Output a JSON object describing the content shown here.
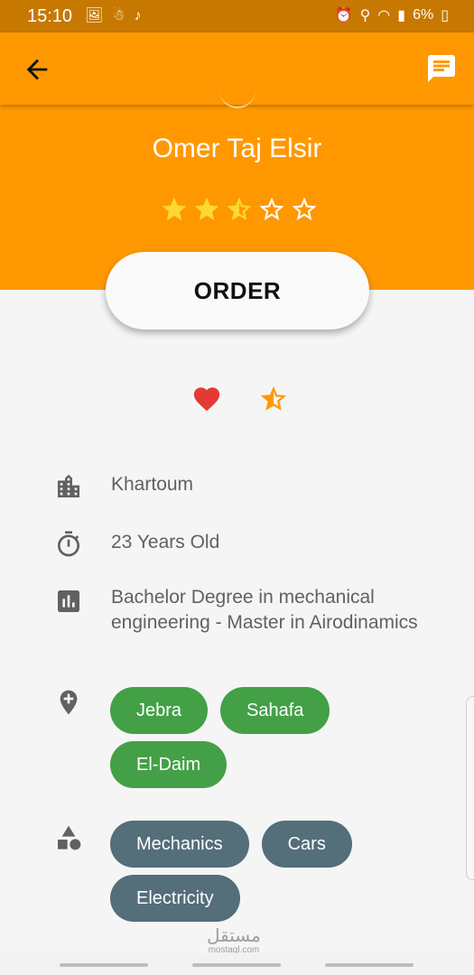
{
  "status_bar": {
    "time": "15:10",
    "battery": "6%",
    "left_icons": [
      "image-icon",
      "snapchat-icon",
      "tiktok-icon"
    ],
    "right_icons": [
      "alarm-icon",
      "location-icon",
      "wifi-icon",
      "signal-icon",
      "battery-icon"
    ]
  },
  "app_bar": {
    "back_icon": "arrow-back-icon",
    "chat_icon": "chat-icon"
  },
  "profile": {
    "name": "Omer Taj Elsir",
    "rating": 2.5,
    "rating_max": 5
  },
  "order_button": {
    "label": "ORDER"
  },
  "actions": {
    "favorite_icon": "heart-icon",
    "rate_icon": "star-half-icon"
  },
  "details": {
    "city": "Khartoum",
    "age": "23 Years Old",
    "education": "Bachelor Degree in mechanical engineering - Master in Airodinamics",
    "areas": [
      "Jebra",
      "Sahafa",
      "El-Daim"
    ],
    "skills": [
      "Mechanics",
      "Cars",
      "Electricity"
    ]
  },
  "watermark": {
    "arabic": "مستقل",
    "latin": "mostaql.com"
  },
  "colors": {
    "primary": "#ff9800",
    "status_bar": "#c77800",
    "star": "#fdd835",
    "heart": "#e53935",
    "area_chip": "#43a047",
    "skill_chip": "#546e7a",
    "text_secondary": "#616161"
  }
}
